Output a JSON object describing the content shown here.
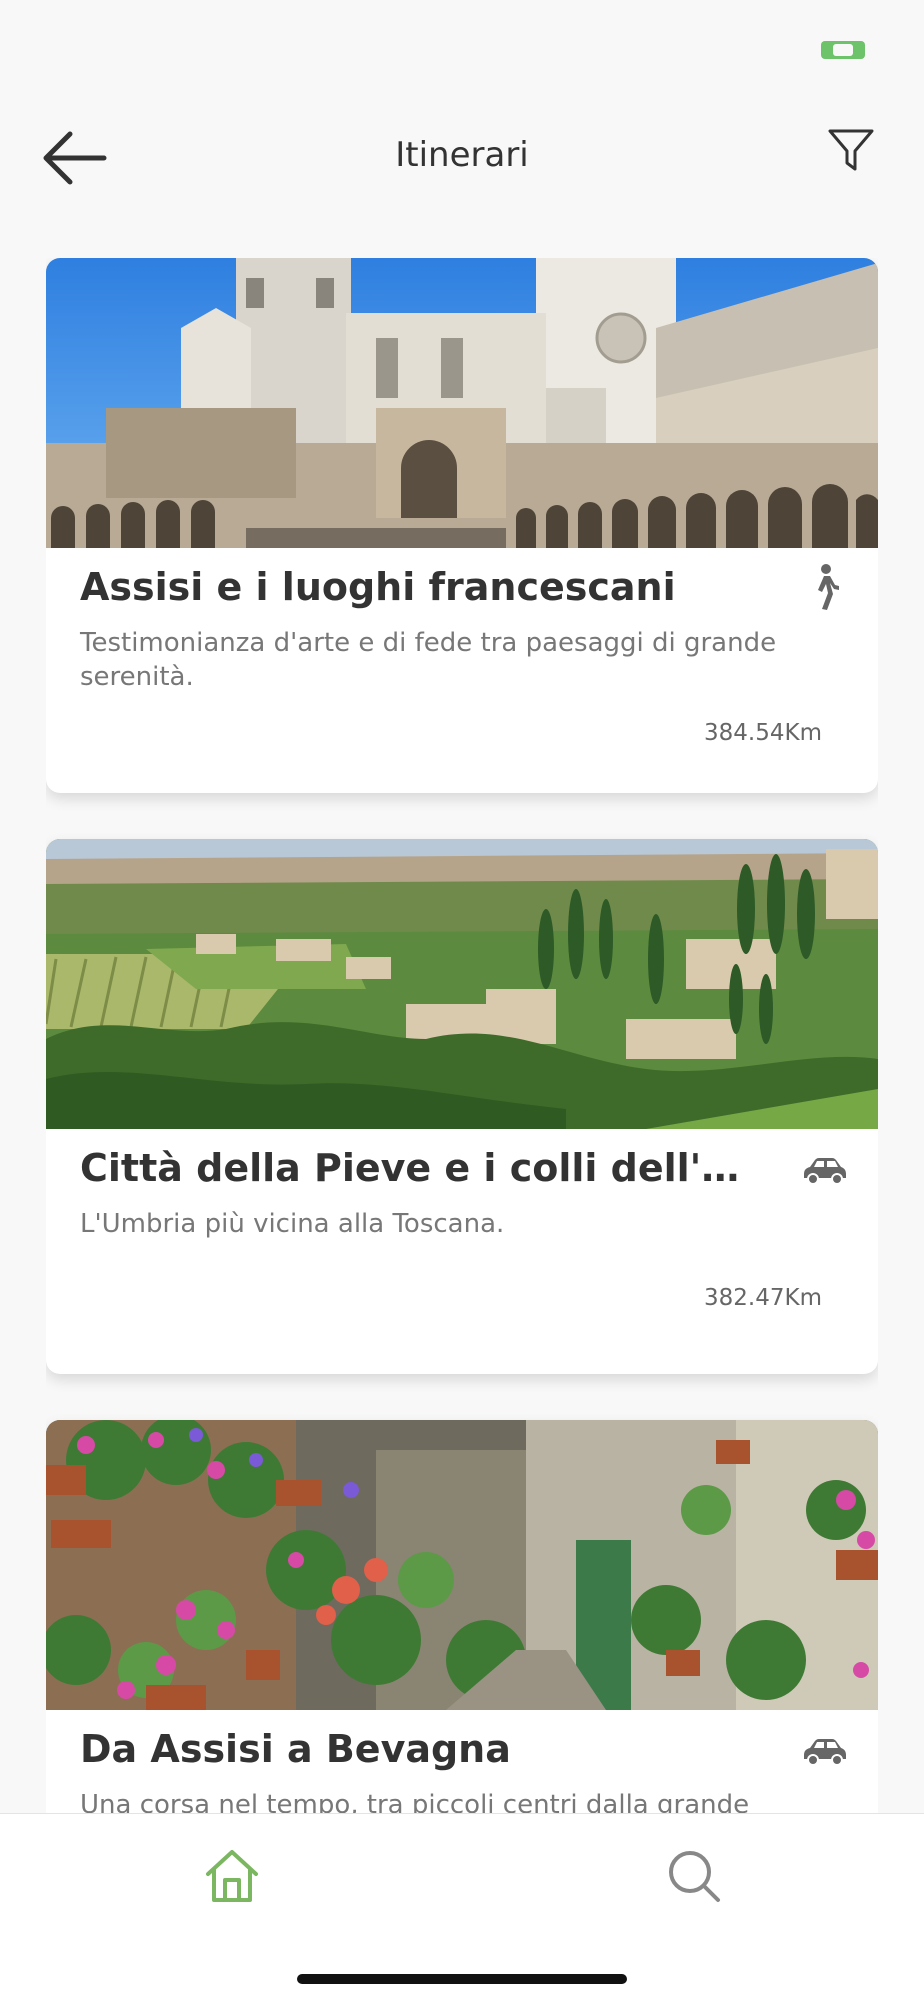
{
  "header": {
    "title": "Itinerari"
  },
  "icons": {
    "back": "arrow-left-icon",
    "filter": "filter-icon",
    "walk": "walking-person-icon",
    "car": "car-icon",
    "home": "home-icon",
    "search": "search-icon"
  },
  "colors": {
    "accent": "#7bb661",
    "text_primary": "#333333",
    "text_secondary": "#777777",
    "status_indicator": "#6cc36a"
  },
  "itineraries": [
    {
      "title": "Assisi e i luoghi francescani",
      "description": "Testimonianza d'arte e di fede tra paesaggi di grande serenità.",
      "distance": "384.54Km",
      "mode": "walk"
    },
    {
      "title": "Città della Pieve e i colli dell'U...",
      "description": "L'Umbria più vicina alla Toscana.",
      "distance": "382.47Km",
      "mode": "car"
    },
    {
      "title": "Da Assisi a Bevagna",
      "description": "Una corsa nel tempo, tra piccoli centri dalla grande",
      "distance": "",
      "mode": "car"
    }
  ],
  "bottom_nav": {
    "active_tab": "home",
    "tabs": [
      "home",
      "search"
    ]
  }
}
